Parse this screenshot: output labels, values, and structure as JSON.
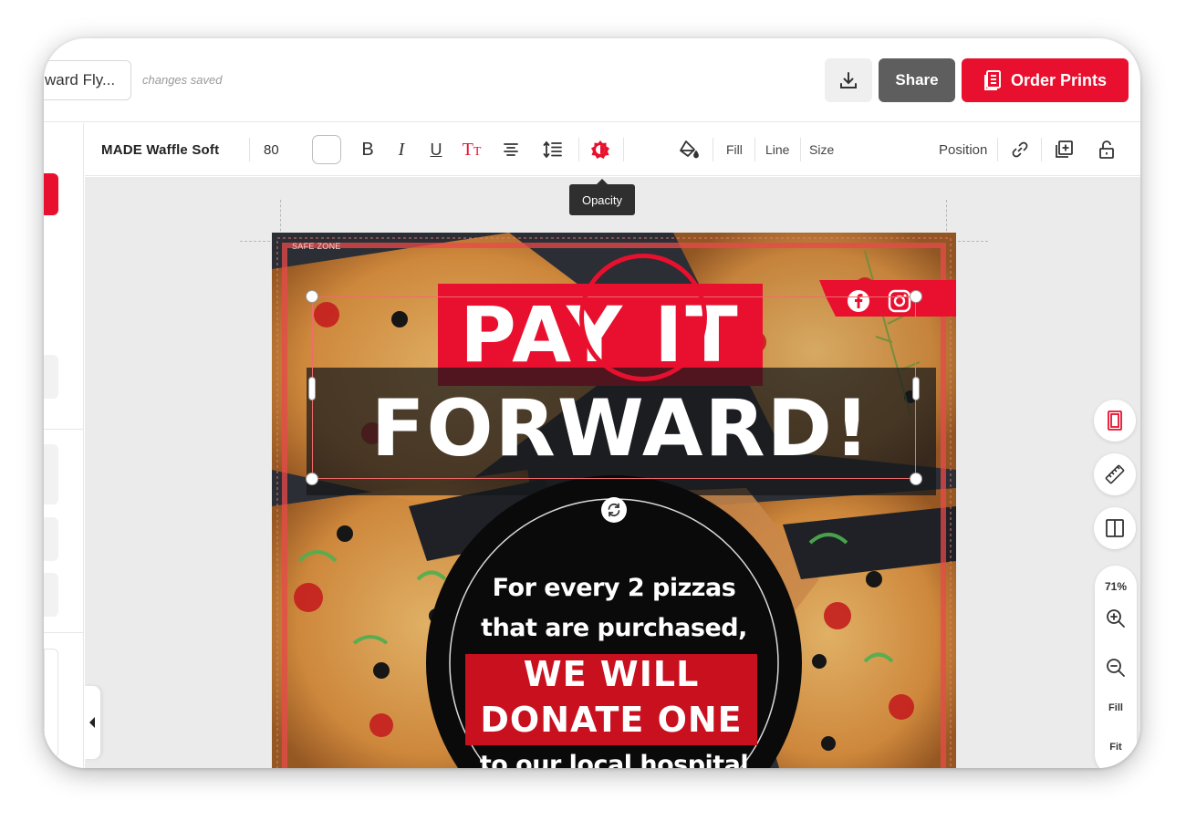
{
  "header": {
    "doc_title": "ward Fly...",
    "saved_status": "changes saved",
    "share_label": "Share",
    "order_label": "Order Prints"
  },
  "toolbar": {
    "font_name": "MADE Waffle Soft",
    "font_size": "80",
    "fill_label": "Fill",
    "line_label": "Line",
    "size_label": "Size",
    "position_label": "Position",
    "tooltip": "Opacity"
  },
  "flyer": {
    "safe_zone": "SAFE ZONE",
    "headline_1": "PAY IT",
    "headline_2": "FORWARD!",
    "badge_line_1": "For every 2 pizzas",
    "badge_line_2": "that are purchased,",
    "badge_line_3": "WE WILL",
    "badge_line_4": "DONATE ONE",
    "badge_line_5": "to our local hospital"
  },
  "zoom": {
    "percent": "71%",
    "fill_label": "Fill",
    "fit_label": "Fit"
  },
  "colors": {
    "brand_red": "#e8102e",
    "dark_gray": "#5e5e5e"
  },
  "icons": [
    "download-icon",
    "print-icon",
    "bold-icon",
    "italic-icon",
    "underline-icon",
    "text-case-icon",
    "align-icon",
    "line-spacing-icon",
    "opacity-icon",
    "fill-bucket-icon",
    "link-icon",
    "duplicate-icon",
    "unlock-icon",
    "trash-icon",
    "facebook-icon",
    "instagram-icon",
    "rotate-icon",
    "page-view-icon",
    "ruler-icon",
    "split-view-icon",
    "zoom-in-icon",
    "zoom-out-icon",
    "collapse-left-icon"
  ]
}
